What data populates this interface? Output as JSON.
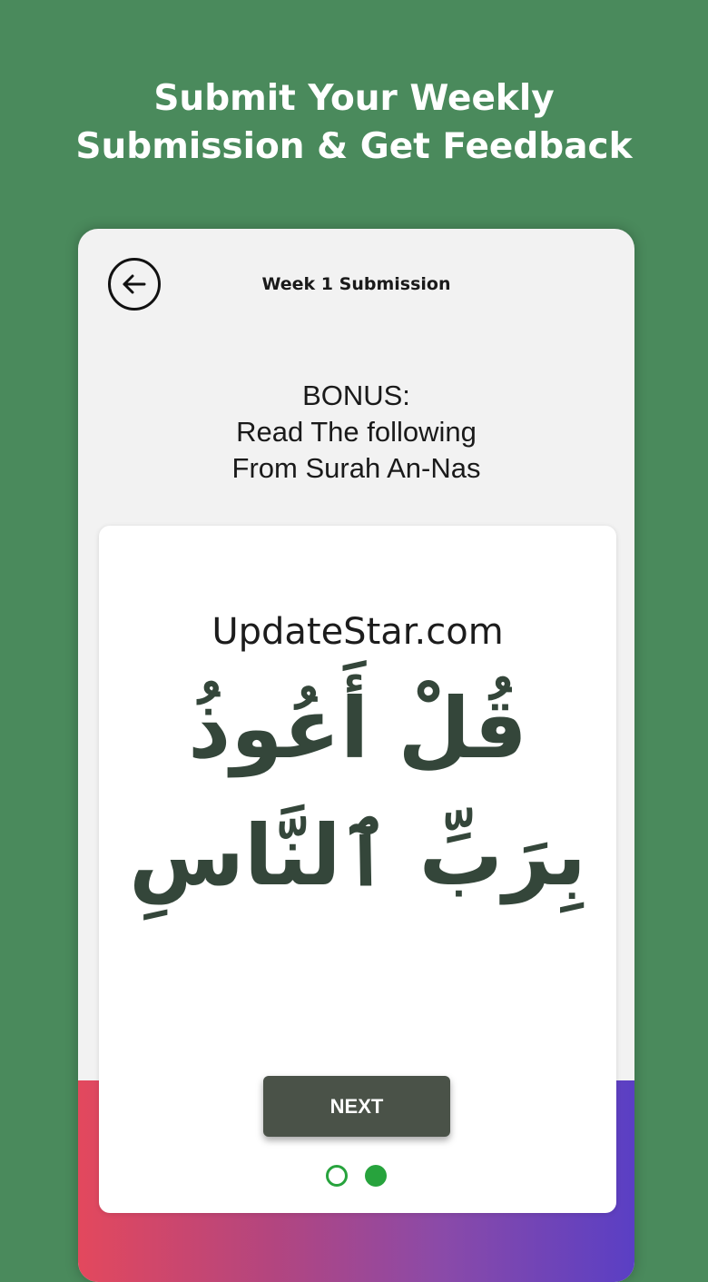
{
  "banner": {
    "line1": "Submit Your Weekly",
    "line2": "Submission & Get Feedback"
  },
  "topbar": {
    "back_icon": "arrow-left-icon",
    "title": "Week 1 Submission"
  },
  "instructions": {
    "line1": "BONUS:",
    "line2": "Read The following",
    "line3": "From Surah An-Nas"
  },
  "card": {
    "watermark": "UpdateStar.com",
    "arabic_line1": "قُلْ أَعُوذُ",
    "arabic_line2": "بِرَبِّ ٱلنَّاسِ"
  },
  "next_label": "NEXT",
  "pagination": {
    "total": 2,
    "current": 2
  },
  "colors": {
    "background": "#4a8a5c",
    "button": "#4a5248",
    "dot_active": "#27a33d",
    "arabic_text": "#34463a"
  }
}
